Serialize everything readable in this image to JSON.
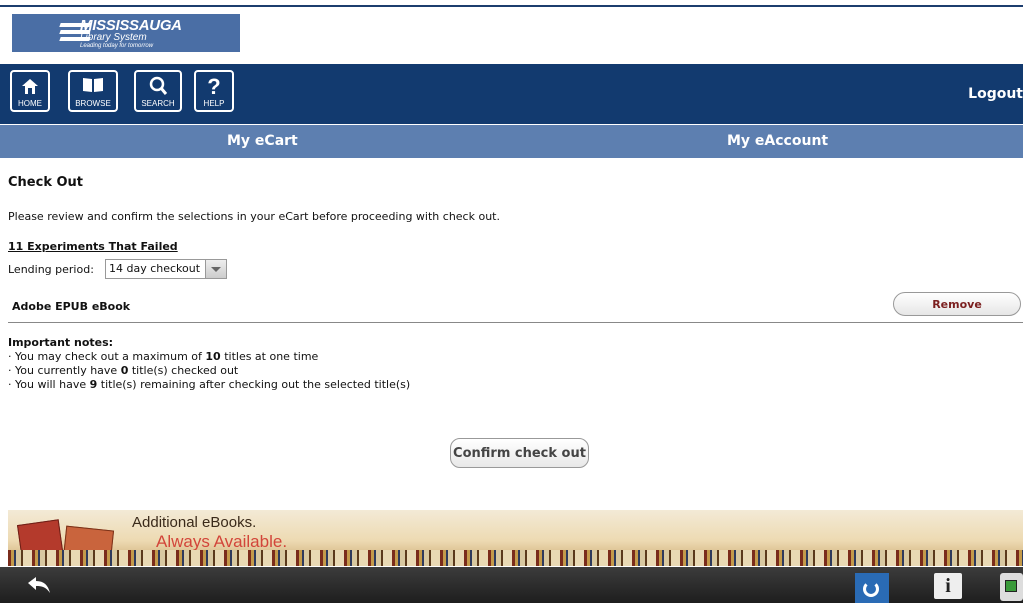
{
  "logo": {
    "line1": "MISSISSAUGA",
    "line2": "Library System",
    "line3": "Leading today for tomorrow"
  },
  "nav": {
    "buttons": [
      {
        "label": "HOME",
        "icon": "home-icon"
      },
      {
        "label": "BROWSE",
        "icon": "book-icon"
      },
      {
        "label": "SEARCH",
        "icon": "search-icon"
      },
      {
        "label": "HELP",
        "icon": "help-icon"
      }
    ],
    "logout": "Logout"
  },
  "tabs": {
    "ecart": "My eCart",
    "eaccount": "My eAccount"
  },
  "checkout": {
    "heading": "Check Out",
    "intro": "Please review and confirm the selections in your eCart before proceeding with check out.",
    "title": "11 Experiments That Failed",
    "lending_label": "Lending period:",
    "lending_value": "14 day checkout",
    "format": "Adobe EPUB eBook",
    "remove": "Remove",
    "confirm": "Confirm check out"
  },
  "notes": {
    "heading": "Important notes:",
    "n1_pre": "· You may check out a maximum of ",
    "n1_num": "10",
    "n1_post": " titles at one time",
    "n2_pre": "· You currently have ",
    "n2_num": "0",
    "n2_post": " title(s) checked out",
    "n3_pre": "· You will have ",
    "n3_num": "9",
    "n3_post": " title(s) remaining after checking out the selected title(s)"
  },
  "banner": {
    "line1": "Additional eBooks.",
    "line2": "Always Available."
  },
  "system": {
    "info": "i"
  },
  "colors": {
    "nav_bg": "#123a6f",
    "tab_bg": "#5d7fb0",
    "remove_text": "#7b1f1f"
  }
}
